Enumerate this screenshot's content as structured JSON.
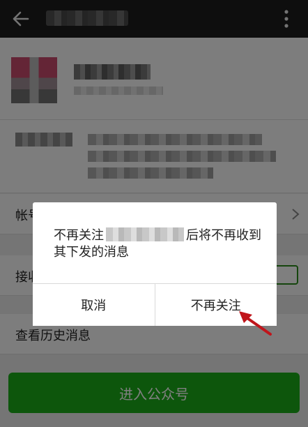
{
  "header": {
    "back_icon": "arrow-left-icon",
    "more_icon": "more-vertical-icon"
  },
  "rows": {
    "account_label": "帐号",
    "receive_label": "接收",
    "history_label": "查看历史消息",
    "chevron_icon": "chevron-right-icon"
  },
  "enter_button": "进入公众号",
  "dialog": {
    "msg_before": "不再关注",
    "msg_after": "后将不再收到其下发的消息",
    "cancel": "取消",
    "confirm": "不再关注"
  },
  "annotation": {
    "arrow_color": "#c0151b"
  },
  "colors": {
    "topbar": "#1d1d1d",
    "primary_green": "#1aad19"
  }
}
